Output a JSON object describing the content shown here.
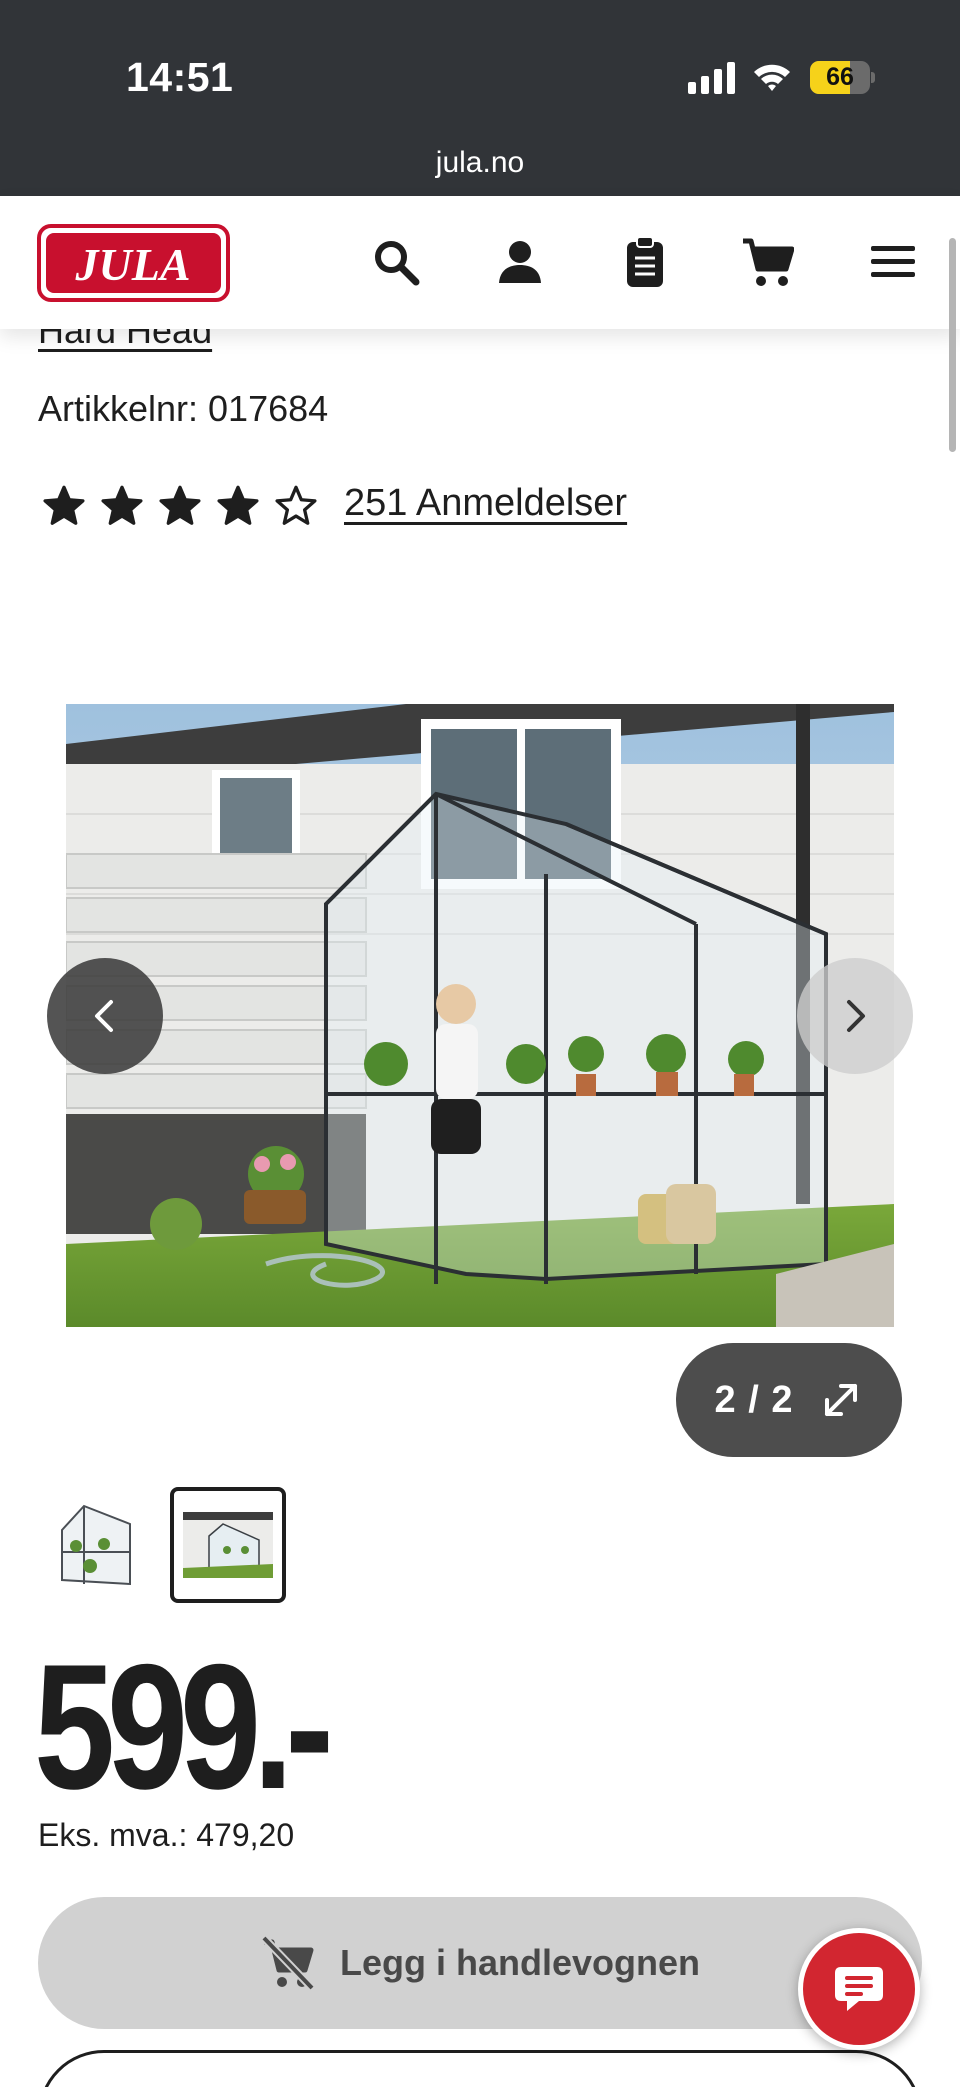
{
  "status_bar": {
    "time": "14:51",
    "battery": 66,
    "url": "jula.no"
  },
  "header": {
    "logo_text": "JULA",
    "icons": [
      "search-icon",
      "account-icon",
      "shopping-list-icon",
      "cart-icon",
      "menu-icon"
    ]
  },
  "product": {
    "brand": "Hard Head",
    "article_number": "Artikkelnr: 017684",
    "rating": 4,
    "rating_max": 5,
    "reviews_label": "251 Anmeldelser"
  },
  "gallery": {
    "counter": "2 / 2",
    "current": 2,
    "total": 2
  },
  "price": {
    "amount": "599.-",
    "ex_vat": "Eks. mva.: 479,20"
  },
  "actions": {
    "add_to_cart": "Legg i handlevognen"
  },
  "colors": {
    "brand_red": "#d22630",
    "statusbar": "#313438",
    "text": "#1e1e1e",
    "button_disabled": "#d1d1d1"
  }
}
